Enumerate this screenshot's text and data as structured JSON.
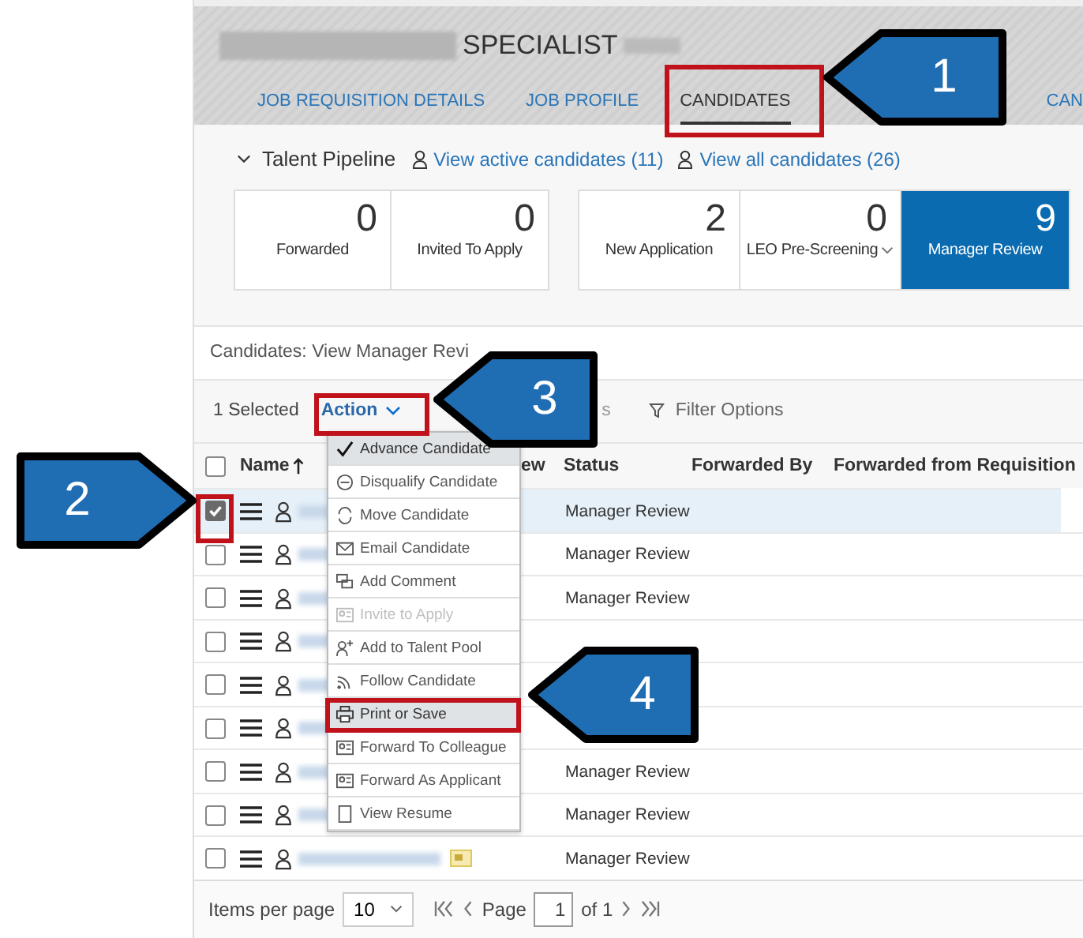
{
  "header": {
    "title": "SPECIALIST"
  },
  "tabs": [
    {
      "label": "JOB REQUISITION DETAILS",
      "selected": false
    },
    {
      "label": "JOB PROFILE",
      "selected": false
    },
    {
      "label": "CANDIDATES",
      "selected": true
    },
    {
      "label": "CAN",
      "selected": false
    }
  ],
  "pipeline": {
    "title": "Talent Pipeline",
    "expanded": true,
    "links": [
      "View active candidates (11)",
      "View all candidates (26)"
    ]
  },
  "tile_groups": [
    [
      {
        "count": "0",
        "label": "Forwarded",
        "selected": false
      },
      {
        "count": "0",
        "label": "Invited To Apply",
        "selected": false
      }
    ],
    [
      {
        "count": "2",
        "label": "New Application",
        "selected": false
      },
      {
        "count": "0",
        "label": "LEO Pre-Screening",
        "dropdown": true,
        "selected": false
      },
      {
        "count": "9",
        "label": "Manager Review",
        "selected": true
      }
    ]
  ],
  "caption": "Candidates: View Manager Revi",
  "toolbar": {
    "selected_count": "1 Selected",
    "action": "Action",
    "hidden_tail": "s",
    "filter": "Filter Options"
  },
  "table": {
    "select_all_checked": false,
    "columns": [
      "Name",
      "ew",
      "Status",
      "Forwarded By",
      "Forwarded from Requisition"
    ],
    "rows": [
      {
        "kind": "plain",
        "checked": true,
        "status": "Manager Review"
      },
      {
        "kind": "plain",
        "checked": false,
        "status": "Manager Review"
      },
      {
        "kind": "plain",
        "checked": false,
        "status": "Manager Review"
      },
      {
        "kind": "plain",
        "checked": false
      },
      {
        "kind": "plain",
        "checked": false
      },
      {
        "kind": "plain",
        "checked": false
      },
      {
        "kind": "plain",
        "checked": false,
        "status": "Manager Review"
      },
      {
        "kind": "plain",
        "checked": false,
        "status": "Manager Review"
      },
      {
        "kind": "resume",
        "checked": false,
        "status": "Manager Review"
      }
    ]
  },
  "action_menu": [
    {
      "label": "Advance Candidate",
      "kind": "check",
      "disabled": false,
      "selected": true
    },
    {
      "label": "Disqualify Candidate",
      "kind": "minus",
      "disabled": false,
      "selected": false
    },
    {
      "label": "Move Candidate",
      "kind": "cycle",
      "disabled": false,
      "selected": false
    },
    {
      "label": "Email Candidate",
      "kind": "mail",
      "disabled": false,
      "selected": false
    },
    {
      "label": "Add Comment",
      "kind": "comment",
      "disabled": false,
      "selected": false
    },
    {
      "label": "Invite to Apply",
      "kind": "card",
      "disabled": true,
      "selected": false
    },
    {
      "label": "Add to Talent Pool",
      "kind": "personplus",
      "disabled": false,
      "selected": false
    },
    {
      "label": "Follow Candidate",
      "kind": "rss",
      "disabled": false,
      "selected": false
    },
    {
      "label": "Print or Save",
      "kind": "print",
      "disabled": false,
      "selected": true
    },
    {
      "label": "Forward To Colleague",
      "kind": "card",
      "disabled": false,
      "selected": false
    },
    {
      "label": "Forward As Applicant",
      "kind": "card",
      "disabled": false,
      "selected": false
    },
    {
      "label": "View Resume",
      "kind": "doc",
      "disabled": false,
      "selected": false
    }
  ],
  "footer": {
    "items_label": "Items per page",
    "items_value": "10",
    "page_label": "Page",
    "page_value": "1",
    "page_total": "of 1"
  },
  "callouts": [
    {
      "label": "1"
    },
    {
      "label": "2"
    },
    {
      "label": "3"
    },
    {
      "label": "4"
    }
  ]
}
